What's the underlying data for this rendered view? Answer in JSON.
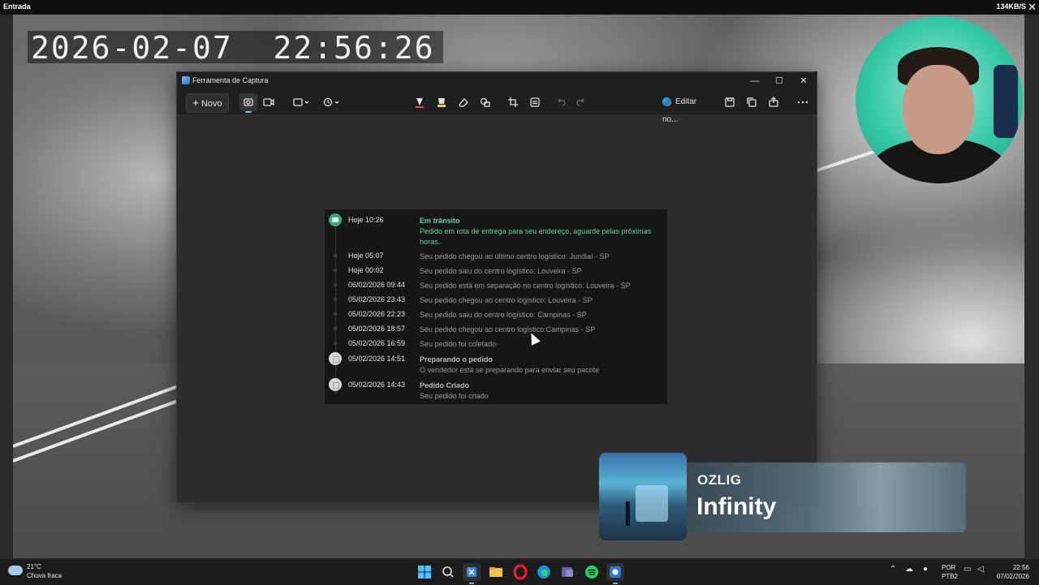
{
  "viewer": {
    "title": "Entrada",
    "speed": "134KB/S",
    "close": "✕"
  },
  "camera": {
    "timestamp": "2026-02-07  22:56:26"
  },
  "window": {
    "title": "Ferramenta de Captura",
    "controls": {
      "minimize": "—",
      "maximize": "☐",
      "close": "✕"
    },
    "toolbar": {
      "new_label": "Novo",
      "edit_label": "Editar no...",
      "icons": [
        "camera-icon",
        "video-icon",
        "rectangle-mode-icon",
        "timer-icon",
        "pen-icon",
        "highlighter-icon",
        "eraser-icon",
        "shapes-icon",
        "crop-icon",
        "text-actions-icon",
        "undo-icon",
        "redo-icon",
        "globe-icon",
        "save-icon",
        "copy-icon",
        "share-icon",
        "more-icon"
      ]
    }
  },
  "tracking": {
    "events": [
      {
        "date": "Hoje 10:26",
        "title": "Em trânsito",
        "message": "Pedido em rota de entrega para seu endereço, aguarde pelas próximas horas.",
        "status": "current"
      },
      {
        "date": "Hoje 05:07",
        "title": "",
        "message": "Seu pedido chegou ao último centro logístico: Jundiaí - SP",
        "status": "minor"
      },
      {
        "date": "Hoje 00:02",
        "title": "",
        "message": "Seu pedido saiu do centro logístico: Louveira - SP",
        "status": "minor"
      },
      {
        "date": "06/02/2026 09:44",
        "title": "",
        "message": "Seu pedido está em separação no centro logístico: Louveira - SP",
        "status": "minor"
      },
      {
        "date": "05/02/2026 23:43",
        "title": "",
        "message": "Seu pedido chegou ao centro logístico: Louveira - SP",
        "status": "minor"
      },
      {
        "date": "05/02/2026 22:23",
        "title": "",
        "message": "Seu pedido saiu do centro logístico: Campinas - SP",
        "status": "minor"
      },
      {
        "date": "05/02/2026 18:57",
        "title": "",
        "message": "Seu pedido chegou ao centro logístico:Campinas - SP",
        "status": "minor"
      },
      {
        "date": "05/02/2026 16:59",
        "title": "",
        "message": "Seu pedido foi coletado",
        "status": "minor"
      },
      {
        "date": "05/02/2026 14:51",
        "title": "Preparando o pedido",
        "message": "O vendedor está se preparando para enviar seu pacote",
        "status": "milestone"
      },
      {
        "date": "05/02/2026 14:43",
        "title": "Pedido Criado",
        "message": "Seu pedido foi criado",
        "status": "milestone"
      }
    ]
  },
  "now_playing": {
    "artist": "OZLIG",
    "song": "Infinity"
  },
  "taskbar": {
    "weather": {
      "temp": "21°C",
      "condition": "Chuva fraca"
    },
    "apps": [
      "windows-start-icon",
      "search-icon",
      "snipping-tool-icon",
      "file-explorer-icon",
      "opera-icon",
      "edge-icon",
      "teams-icon",
      "spotify-icon",
      "app-icon"
    ],
    "language": {
      "line1": "POR",
      "line2": "PTB2"
    },
    "clock": {
      "time": "22:56",
      "date": "07/02/2026"
    }
  },
  "colors": {
    "accent_green": "#5fd3a0",
    "window_bg": "#2c2c2c",
    "card_bg": "#161616",
    "taskbar_bg": "#1c1c1c"
  }
}
